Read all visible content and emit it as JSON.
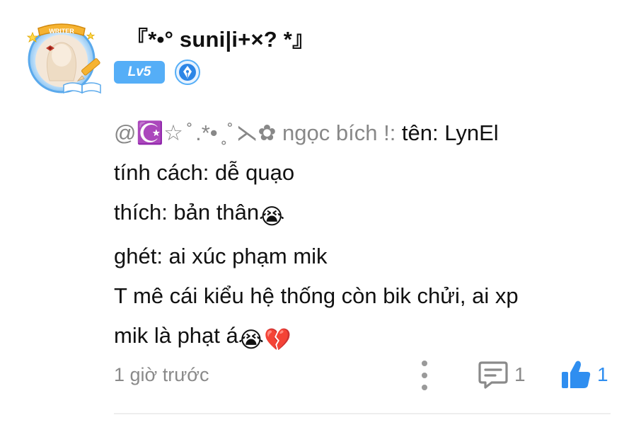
{
  "comment": {
    "author": {
      "name": "『*•° suni|i+×? *』",
      "level_badge": "Lv5",
      "avatar_frame_label": "WRITER",
      "role_badge_icon": "pen-nib-icon",
      "accent_color": "#55aef7"
    },
    "body": {
      "mention": "@☪️☆ ̊ .*• ̥ ̊ ⋋✿ ngọc bích !:",
      "line1_rest": " tên: LynEl",
      "line2": "tính cách: dễ quạo",
      "line3": "thích: bản thân",
      "line3_emoji": "😭",
      "line4": "ghét: ai xúc phạm mik",
      "line5": "T mê cái kiểu hệ thống còn bik chửi, ai xp",
      "line6": "mik là phạt á",
      "line6_emoji1": "😭",
      "line6_emoji2": "💔"
    },
    "timestamp": "1 giờ trước",
    "actions": {
      "more_icon": "more-vertical-icon",
      "reply_icon": "comment-icon",
      "reply_count": "1",
      "like_icon": "thumbs-up-icon",
      "like_count": "1",
      "like_color": "#2f8ef0"
    }
  }
}
